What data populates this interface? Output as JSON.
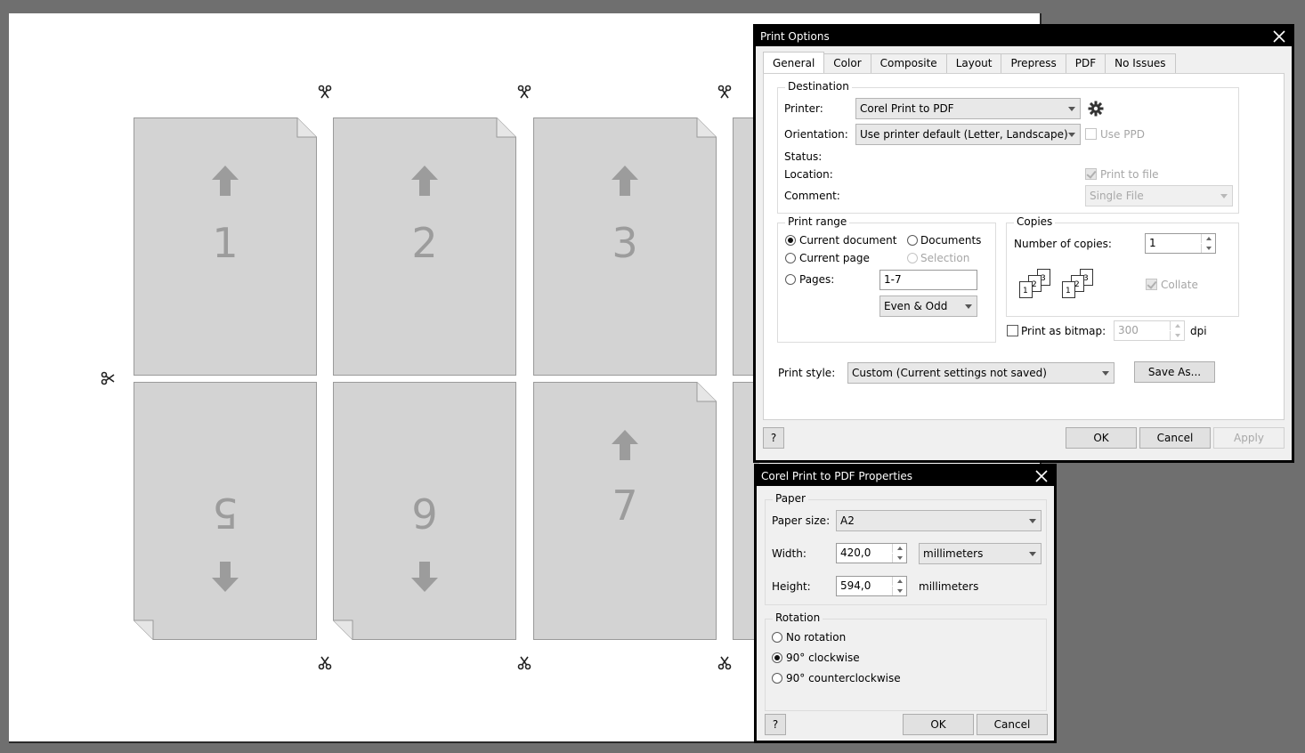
{
  "preview": {
    "pages_top": [
      "1",
      "2",
      "3"
    ],
    "pages_bottom": [
      "5",
      "6",
      "7"
    ]
  },
  "print_options": {
    "title": "Print Options",
    "tabs": [
      "General",
      "Color",
      "Composite",
      "Layout",
      "Prepress",
      "PDF",
      "No Issues"
    ],
    "active_tab": "General",
    "destination": {
      "heading": "Destination",
      "printer_label": "Printer:",
      "printer_value": "Corel Print to PDF",
      "orientation_label": "Orientation:",
      "orientation_value": "Use printer default (Letter, Landscape)",
      "use_ppd_label": "Use PPD",
      "status_label": "Status:",
      "location_label": "Location:",
      "comment_label": "Comment:",
      "print_to_file_label": "Print to file",
      "single_file_value": "Single File"
    },
    "print_range": {
      "heading": "Print range",
      "current_document": "Current document",
      "documents": "Documents",
      "current_page": "Current page",
      "selection": "Selection",
      "pages": "Pages:",
      "pages_value": "1-7",
      "even_odd_value": "Even & Odd"
    },
    "copies": {
      "heading": "Copies",
      "number_label": "Number of copies:",
      "number_value": "1",
      "collate_label": "Collate"
    },
    "bitmap": {
      "label": "Print as bitmap:",
      "dpi_value": "300",
      "dpi_unit": "dpi"
    },
    "print_style": {
      "label": "Print style:",
      "value": "Custom (Current settings not saved)",
      "save_as": "Save As..."
    },
    "buttons": {
      "help": "?",
      "ok": "OK",
      "cancel": "Cancel",
      "apply": "Apply"
    }
  },
  "pdf_properties": {
    "title": "Corel Print to PDF Properties",
    "paper": {
      "heading": "Paper",
      "size_label": "Paper size:",
      "size_value": "A2",
      "width_label": "Width:",
      "width_value": "420,0",
      "unit_value": "millimeters",
      "height_label": "Height:",
      "height_value": "594,0",
      "height_unit": "millimeters"
    },
    "rotation": {
      "heading": "Rotation",
      "none": "No rotation",
      "cw": "90° clockwise",
      "ccw": "90° counterclockwise"
    },
    "buttons": {
      "help": "?",
      "ok": "OK",
      "cancel": "Cancel"
    }
  },
  "icons": [
    "gear-icon",
    "scissors-icon",
    "arrow-up-icon",
    "arrow-down-icon",
    "close-icon",
    "collate-icon"
  ]
}
